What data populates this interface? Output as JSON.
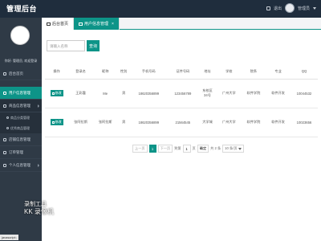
{
  "header": {
    "brand": "管理后台",
    "logout": "退出",
    "user": "管理员"
  },
  "sidebar": {
    "welcome": "你好: 管理员, 欢迎登录",
    "items": [
      {
        "label": "后台首页"
      },
      {
        "label": "用户信息管理"
      },
      {
        "label": "商品信息管理"
      },
      {
        "label": "商品分类管理"
      },
      {
        "label": "优秀商品管理"
      },
      {
        "label": "店铺信息管理"
      },
      {
        "label": "订单管理"
      },
      {
        "label": "个人信息管理"
      }
    ]
  },
  "tabs": [
    {
      "label": "后台首页"
    },
    {
      "label": "用户信息管理",
      "close": "×"
    }
  ],
  "search": {
    "placeholder": "请输入名称",
    "button": "查询"
  },
  "table": {
    "columns": [
      "操作",
      "登录名",
      "昵称",
      "性别",
      "手机号码",
      "证件号码",
      "地址",
      "学校",
      "院系",
      "专业",
      "QQ"
    ],
    "edit_label": "修改",
    "rows": [
      {
        "login": "王彩霞",
        "nick": "Me",
        "gender": "男",
        "phone": "18620356899",
        "id_no": "123456789",
        "address": "东校区\n34号",
        "school": "广州大学",
        "dept": "软件学院",
        "major": "软件开发",
        "qq": "10044532"
      },
      {
        "login": "张阿拉斯",
        "nick": "张阿拉斯",
        "gender": "男",
        "phone": "18620356899",
        "id_no": "21564545",
        "address": "大学城",
        "school": "广州大学",
        "dept": "软件学院",
        "major": "软件开发",
        "qq": "10023656"
      }
    ]
  },
  "pagination": {
    "prev": "上一页",
    "current": "1",
    "next": "下一页",
    "goto_label": "到第",
    "page_input": "1",
    "page_unit": "页",
    "confirm": "确定",
    "total": "共 2 条",
    "per_page": "10 条/页"
  },
  "watermark": {
    "line1": "录制工具",
    "line2": "KK 录像机"
  },
  "status_url": "javascript:;"
}
